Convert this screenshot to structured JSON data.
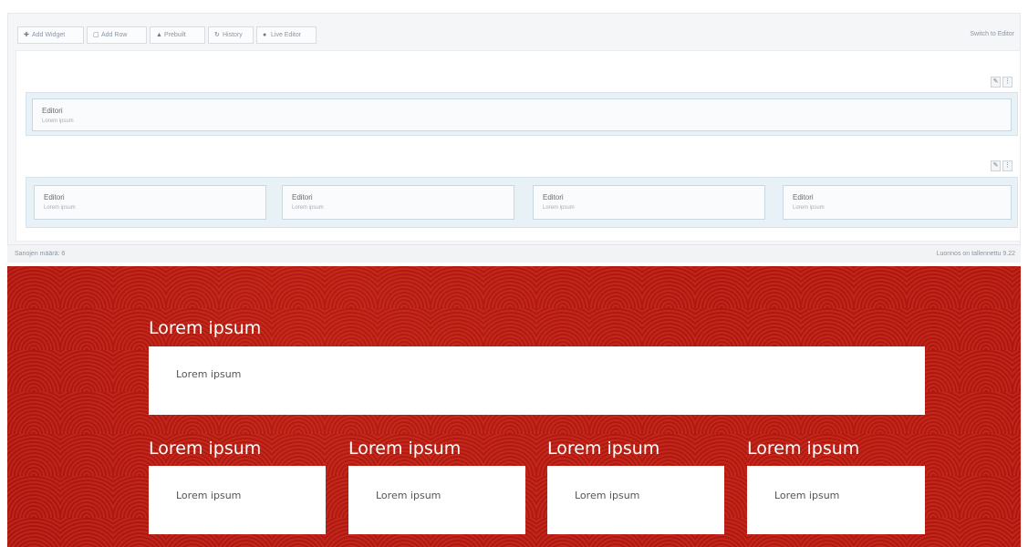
{
  "toolbar": {
    "buttons": [
      {
        "icon": "plus-icon",
        "glyph": "✚",
        "label": "Add Widget"
      },
      {
        "icon": "add-row-icon",
        "glyph": "▢",
        "label": "Add Row"
      },
      {
        "icon": "prebuilt-icon",
        "glyph": "▲",
        "label": "Prebuilt"
      },
      {
        "icon": "history-icon",
        "glyph": "↻",
        "label": "History"
      },
      {
        "icon": "eye-icon",
        "glyph": "●",
        "label": "Live Editor"
      }
    ],
    "switch_label": "Switch to Editor"
  },
  "rows": {
    "row1": {
      "widget": {
        "title": "Editori",
        "subtitle": "Lorem ipsum"
      }
    },
    "row2": {
      "widgets": [
        {
          "title": "Editori",
          "subtitle": "Lorem ipsum"
        },
        {
          "title": "Editori",
          "subtitle": "Lorem ipsum"
        },
        {
          "title": "Editori",
          "subtitle": "Lorem ipsum"
        },
        {
          "title": "Editori",
          "subtitle": "Lorem ipsum"
        }
      ]
    },
    "action_glyphs": {
      "edit": "✎",
      "menu": "⋮"
    }
  },
  "status": {
    "left": "Sanojen määrä: 6",
    "right": "Luonnos on tallennettu 9.22"
  },
  "preview": {
    "heading": "Lorem ipsum",
    "box_text": "Lorem ipsum",
    "columns": [
      {
        "heading": "Lorem ipsum",
        "text": "Lorem ipsum"
      },
      {
        "heading": "Lorem ipsum",
        "text": "Lorem ipsum"
      },
      {
        "heading": "Lorem ipsum",
        "text": "Lorem ipsum"
      },
      {
        "heading": "Lorem ipsum",
        "text": "Lorem ipsum"
      }
    ]
  },
  "colors": {
    "accent_red": "#b8170f",
    "row_bg": "#e8f1f6"
  }
}
